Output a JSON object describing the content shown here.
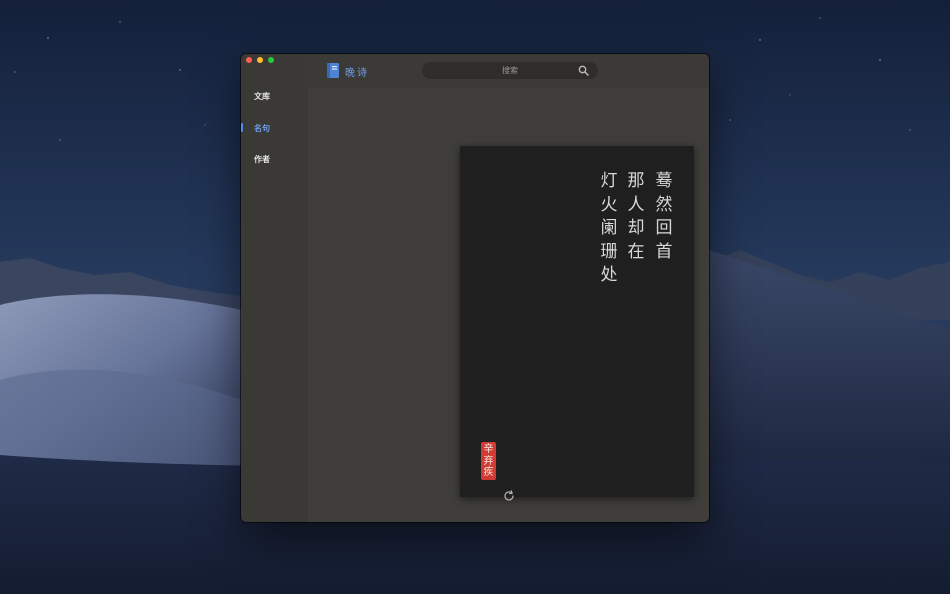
{
  "app": {
    "name": "晚诗",
    "icon": "book-icon",
    "accent_color": "#6f9ee8"
  },
  "window_controls": {
    "close": "close-icon",
    "minimize": "minimize-icon",
    "zoom": "zoom-icon"
  },
  "search": {
    "placeholder": "搜索",
    "icon": "search-icon"
  },
  "sidebar": {
    "items": [
      {
        "label": "文库"
      },
      {
        "label": "名句",
        "selected": true
      },
      {
        "label": "作者"
      }
    ]
  },
  "poem": {
    "columns": [
      "蓦然回首",
      "那人却在",
      "灯火阑珊处"
    ],
    "author": "辛弃疾",
    "seal_color": "#d13b33"
  },
  "footer": {
    "refresh_icon": "refresh-icon"
  }
}
